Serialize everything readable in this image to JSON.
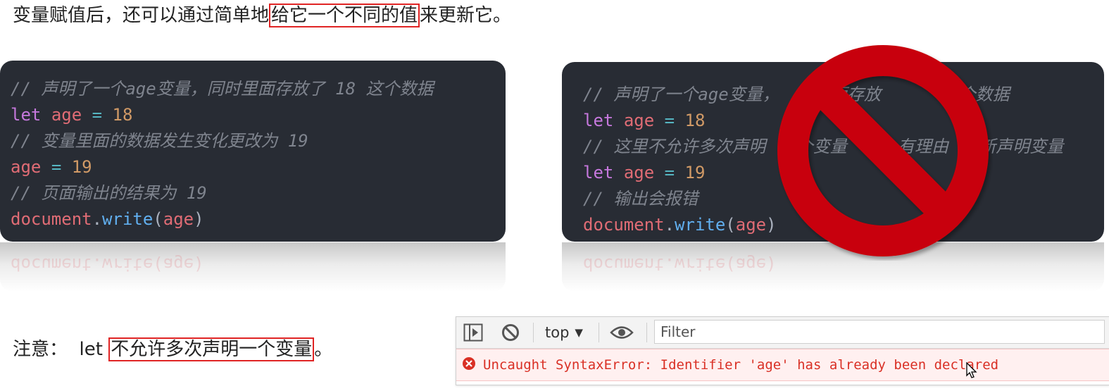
{
  "intro": {
    "before": "变量赋值后，还可以通过简单地",
    "highlight": "给它一个不同的值",
    "after": "来更新它。"
  },
  "left_code": {
    "comment1": "// 声明了一个age变量，同时里面存放了 18 这个数据",
    "line2_kw": "let",
    "line2_var": "age",
    "line2_op": "=",
    "line2_num": "18",
    "comment3": "// 变量里面的数据发生变化更改为 19",
    "line4_var": "age",
    "line4_op": "=",
    "line4_num": "19",
    "comment5": "// 页面输出的结果为 19",
    "line6_obj": "document",
    "line6_dot": ".",
    "line6_fn": "write",
    "line6_open": "(",
    "line6_arg": "age",
    "line6_close": ")",
    "reflection": "document.write(age)"
  },
  "right_code": {
    "comment1": "// 声明了一个age变量，     面存放      这个数据",
    "line2_kw": "let",
    "line2_var": "age",
    "line2_op": "=",
    "line2_num": "18",
    "comment3": "// 这里不允许多次声明   个变量     有理由   新声明变量",
    "line4_kw": "let",
    "line4_var": "age",
    "line4_op": "=",
    "line4_num": "19",
    "comment5": "// 输出会报错",
    "line6_obj": "document",
    "line6_dot": ".",
    "line6_fn": "write",
    "line6_open": "(",
    "line6_arg": "age",
    "line6_close": ")",
    "reflection": "document.write(age)"
  },
  "overlay": {
    "icon": "no-entry-prohibition-icon",
    "color": "#c8000a"
  },
  "note": {
    "label": "注意：",
    "code": "let",
    "highlight": "不允许多次声明一个变量",
    "after": "。"
  },
  "console": {
    "context": "top",
    "filter_placeholder": "Filter",
    "error_message": "Uncaught SyntaxError: Identifier 'age' has already been declared",
    "error_color": "#d93025",
    "icons": [
      "sidebar-toggle-icon",
      "clear-console-icon",
      "context-dropdown-icon",
      "eye-icon",
      "error-icon"
    ]
  }
}
